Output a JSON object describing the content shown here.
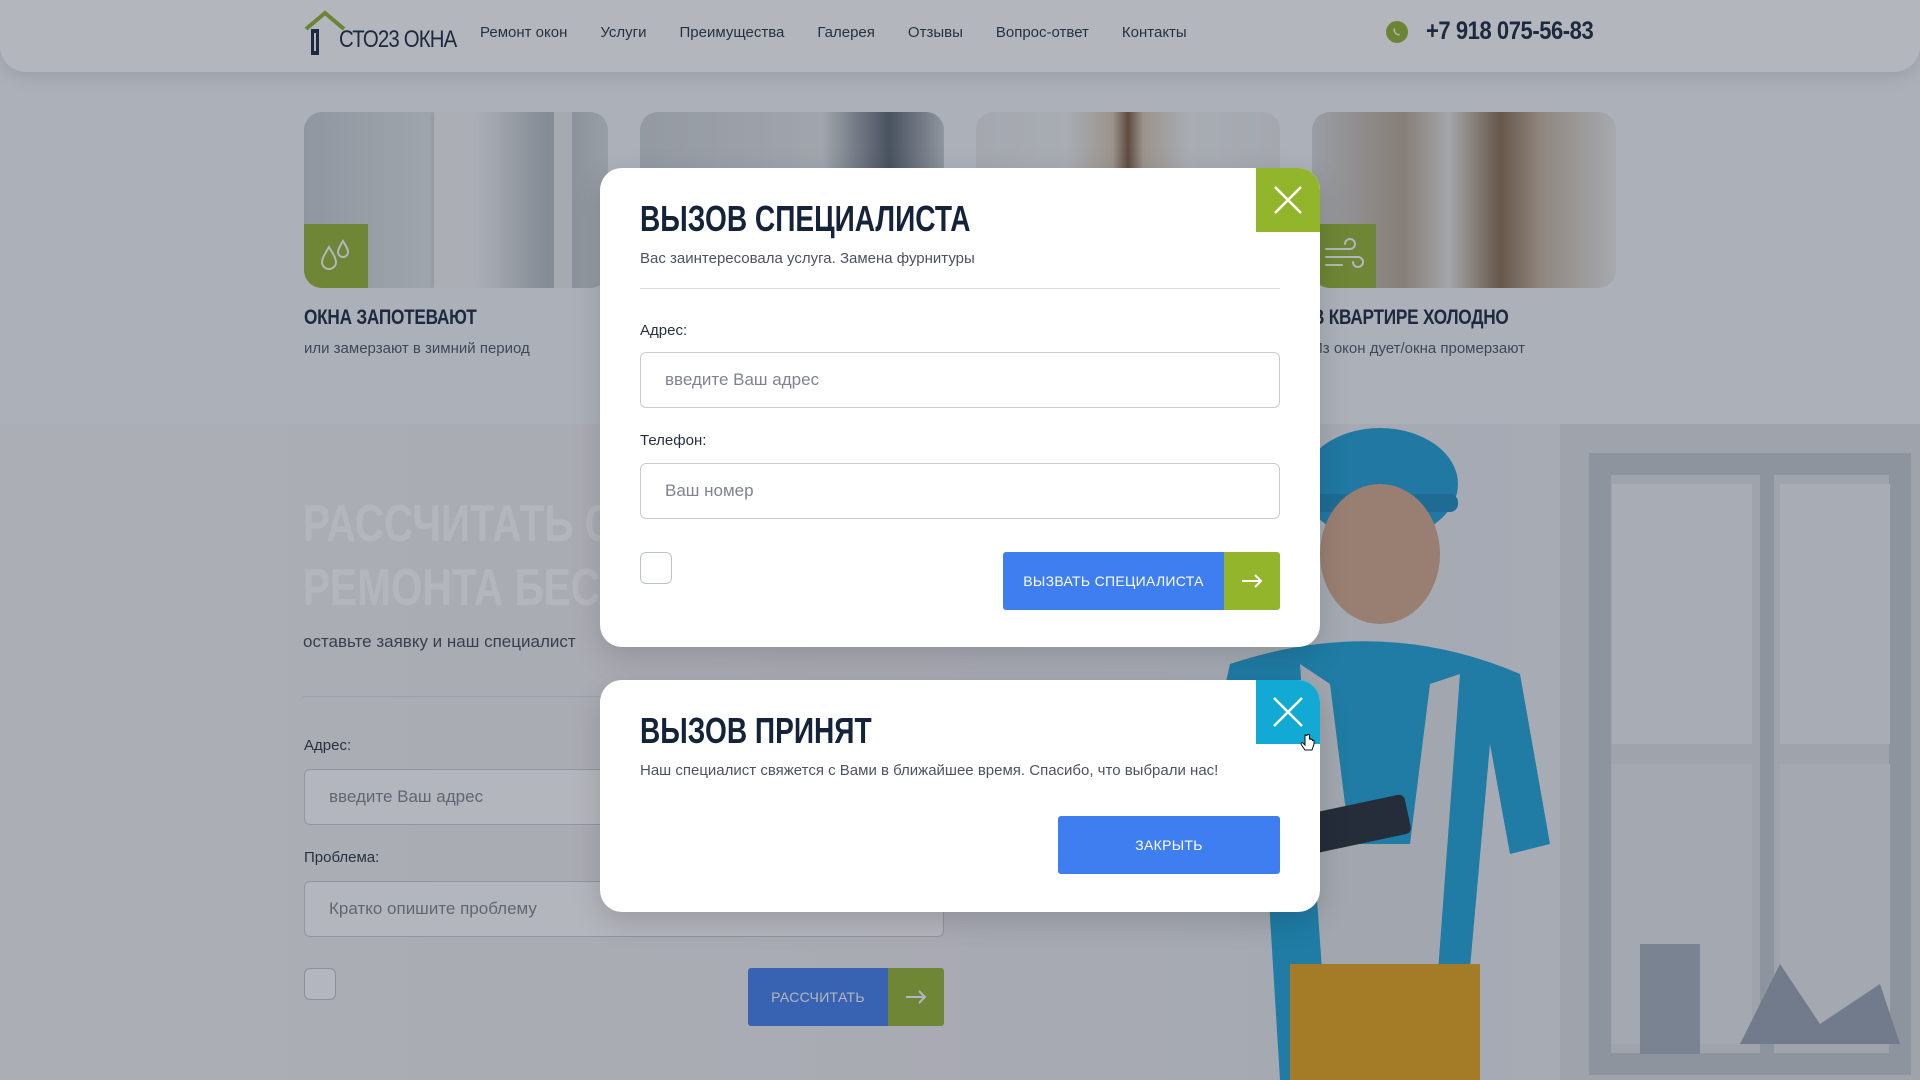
{
  "header": {
    "logo_text": "СТО23 ОКНА",
    "nav": [
      "Ремонт окон",
      "Услуги",
      "Преимущества",
      "Галерея",
      "Отзывы",
      "Вопрос-ответ",
      "Контакты"
    ],
    "phone": "+7 918 075-56-83"
  },
  "problems": [
    {
      "title": "ОКНА ЗАПОТЕВАЮТ",
      "subtitle": "или замерзают в зимний период",
      "icon": "water-drops-icon"
    },
    {
      "title": "",
      "subtitle": "",
      "icon": ""
    },
    {
      "title": "",
      "subtitle": "",
      "icon": ""
    },
    {
      "title": "В КВАРТИРЕ ХОЛОДНО",
      "subtitle": "Из окон дует/окна промерзают",
      "icon": "wind-icon"
    }
  ],
  "calc": {
    "title_line1": "РАССЧИТАТЬ СТ",
    "title_line2": "РЕМОНТА БЕСП",
    "subtitle": "оставьте заявку и наш специалист",
    "address_label": "Адрес:",
    "address_placeholder": "введите Ваш адрес",
    "problem_label": "Проблема:",
    "problem_placeholder": "Кратко опишите проблему",
    "button_label": "РАССЧИТАТЬ"
  },
  "modal_call": {
    "title": "ВЫЗОВ СПЕЦИАЛИСТА",
    "subtitle": "Вас заинтересовала услуга. Замена фурнитуры",
    "address_label": "Адрес:",
    "address_placeholder": "введите Ваш адрес",
    "phone_label": "Телефон:",
    "phone_placeholder": "Ваш номер",
    "button_label": "ВЫЗВАТЬ СПЕЦИАЛИСТА"
  },
  "modal_accepted": {
    "title": "ВЫЗОВ ПРИНЯТ",
    "subtitle": "Наш специалист свяжется с Вами в ближайшее время. Спасибо, что выбрали нас!",
    "button_label": "ЗАКРЫТЬ"
  },
  "colors": {
    "accent_green": "#93b52c",
    "accent_blue": "#3f7ef1",
    "accent_cyan": "#12a9d4",
    "dark_text": "#15233a"
  }
}
